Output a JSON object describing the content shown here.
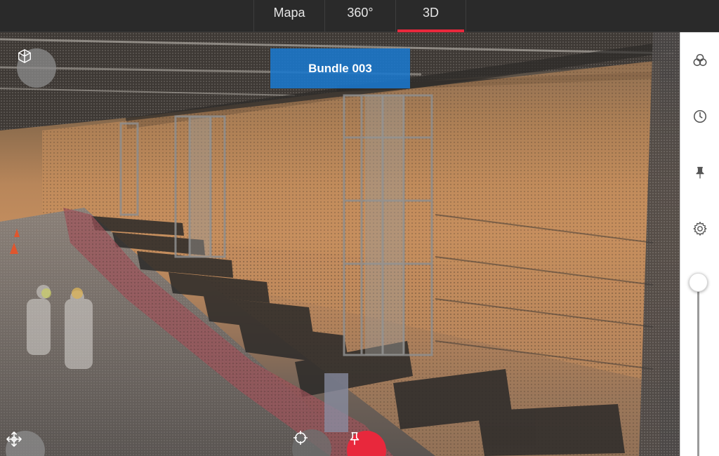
{
  "tabs": [
    {
      "label": "Mapa",
      "active": false
    },
    {
      "label": "360°",
      "active": false
    },
    {
      "label": "3D",
      "active": true
    }
  ],
  "viewer": {
    "bundle_label": "Bundle 003",
    "accent_color": "#e8283c",
    "label_color": "#1a78cd"
  },
  "left_controls": {
    "view_cube_icon": "cube-icon",
    "move_icon": "move-icon"
  },
  "bottom_controls": {
    "locate_icon": "crosshair-icon",
    "pin_icon": "pin-icon"
  },
  "right_toolbar": {
    "items": [
      {
        "icon": "layers-cluster-icon"
      },
      {
        "icon": "clock-icon"
      },
      {
        "icon": "pin-icon"
      },
      {
        "icon": "gear-icon"
      }
    ],
    "slider_value": 1.0
  }
}
